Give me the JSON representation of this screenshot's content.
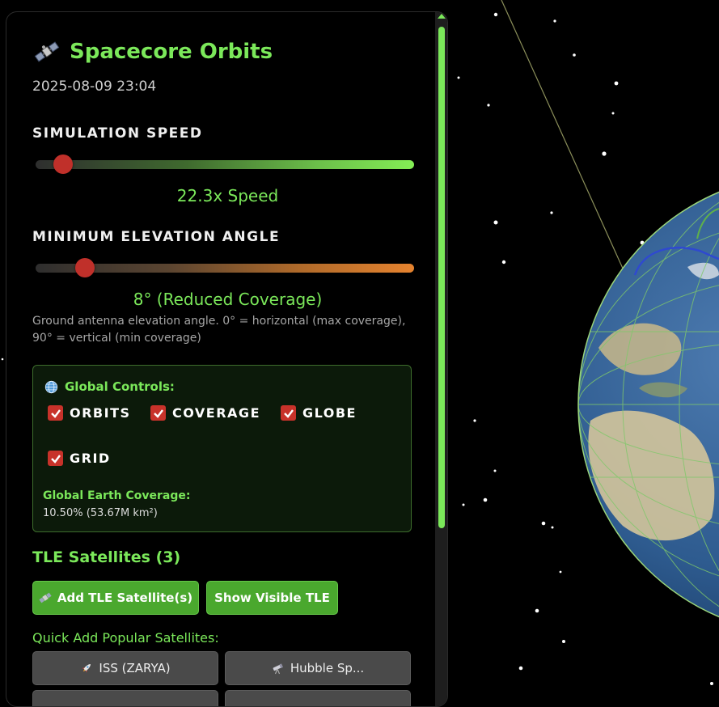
{
  "app": {
    "title": "Spacecore Orbits",
    "datetime": "2025-08-09 23:04"
  },
  "simulation_speed": {
    "label": "SIMULATION SPEED",
    "value_text": "22.3x Speed",
    "slider_fraction": 0.05
  },
  "elevation": {
    "label": "MINIMUM ELEVATION ANGLE",
    "value_text": "8° (Reduced Coverage)",
    "slider_fraction": 0.11,
    "description": "Ground antenna elevation angle. 0° = horizontal (max coverage), 90° = vertical (min coverage)"
  },
  "global_controls": {
    "title": "Global Controls:",
    "checkboxes": [
      {
        "label": "ORBITS",
        "checked": true
      },
      {
        "label": "COVERAGE",
        "checked": true
      },
      {
        "label": "GLOBE",
        "checked": true
      },
      {
        "label": "GRID",
        "checked": true
      }
    ],
    "coverage_label": "Global Earth Coverage:",
    "coverage_value": "10.50% (53.67M km²)"
  },
  "tle": {
    "heading": "TLE Satellites (3)",
    "add_button": "Add TLE Satellite(s)",
    "show_button": "Show Visible TLE",
    "quick_add_label": "Quick Add Popular Satellites:",
    "quick_buttons": [
      {
        "label": "ISS (ZARYA)",
        "icon": "rocket-icon"
      },
      {
        "label": "Hubble Sp...",
        "icon": "telescope-icon"
      }
    ]
  },
  "colors": {
    "accent_green": "#7be85a",
    "button_green": "#4aa82e",
    "slider_thumb": "#c0302a",
    "checkbox_red": "#c8322a"
  }
}
